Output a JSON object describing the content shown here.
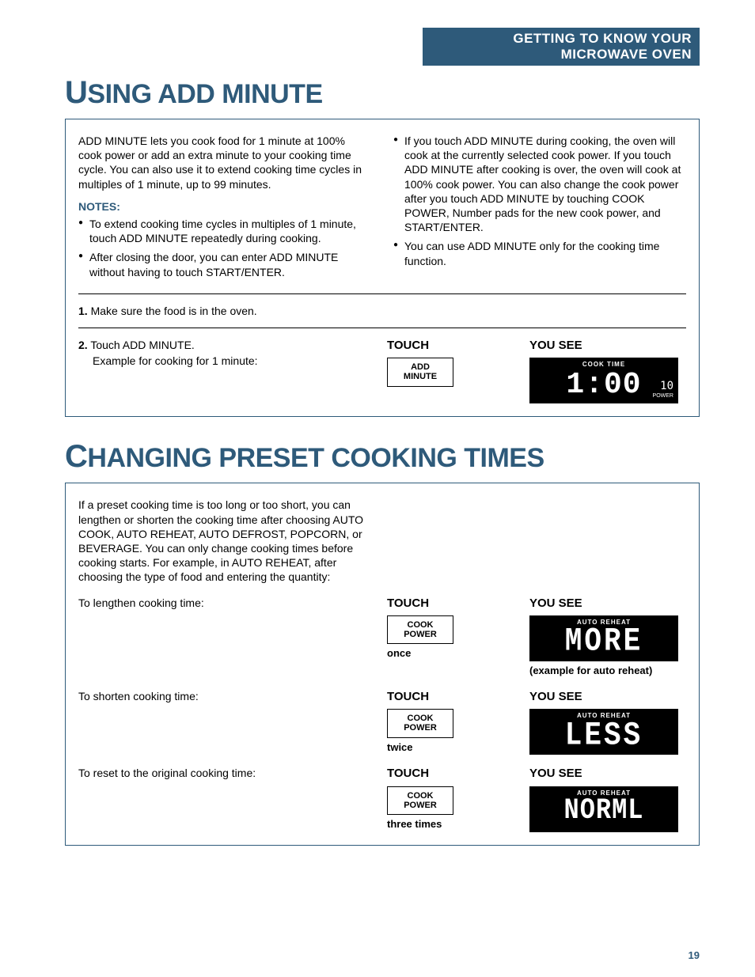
{
  "header": "GETTING TO KNOW YOUR MICROWAVE OVEN",
  "section1": {
    "title_pre": "U",
    "title_rest": "SING ADD MINUTE",
    "intro": "ADD MINUTE lets you cook food for 1 minute at 100% cook power or add an extra minute to your cooking time cycle. You can also use it to extend cooking time cycles in multiples of 1 minute, up to 99 minutes.",
    "notes_label": "NOTES:",
    "left_notes": [
      "To extend cooking time cycles in multiples of 1 minute, touch ADD MINUTE repeatedly during cooking.",
      "After closing the door, you can enter ADD MINUTE without having to touch START/ENTER."
    ],
    "right_notes": [
      "If you touch ADD MINUTE during cooking, the oven will cook at the currently selected cook power. If you touch ADD MINUTE after cooking is over, the oven will cook at 100% cook power. You can also change the cook power after you touch ADD MINUTE by touching COOK POWER, Number pads for the new cook power, and START/ENTER.",
      "You can use ADD MINUTE only for the cooking time function."
    ],
    "step1_num": "1.",
    "step1_text": "Make sure the food is in the oven.",
    "step2_num": "2.",
    "step2_text": "Touch ADD MINUTE.",
    "step2_example": "Example for cooking for 1 minute:",
    "touch_label": "TOUCH",
    "yousee_label": "YOU SEE",
    "button_line1": "ADD",
    "button_line2": "MINUTE",
    "lcd_top": "COOK  TIME",
    "lcd_time": "1:00",
    "lcd_power_num": "10",
    "lcd_power_label": "POWER"
  },
  "section2": {
    "title_pre": "C",
    "title_rest": "HANGING PRESET COOKING TIMES",
    "intro": "If a preset cooking time is too long or too short, you can lengthen or shorten the cooking time after choosing AUTO COOK, AUTO REHEAT, AUTO DEFROST, POPCORN, or BEVERAGE. You can only change cooking times before cooking starts. For example, in AUTO REHEAT, after choosing the type of food and entering the quantity:",
    "rows": [
      {
        "text": "To lengthen cooking time:",
        "touch_label": "TOUCH",
        "button_l1": "COOK",
        "button_l2": "POWER",
        "sub": "once",
        "yousee_label": "YOU SEE",
        "lcd_top": "AUTO  REHEAT",
        "lcd_big": "MORE",
        "caption": "(example for auto reheat)"
      },
      {
        "text": "To shorten cooking time:",
        "touch_label": "TOUCH",
        "button_l1": "COOK",
        "button_l2": "POWER",
        "sub": "twice",
        "yousee_label": "YOU SEE",
        "lcd_top": "AUTO  REHEAT",
        "lcd_big": "LESS",
        "caption": ""
      },
      {
        "text": "To reset to the original cooking time:",
        "touch_label": "TOUCH",
        "button_l1": "COOK",
        "button_l2": "POWER",
        "sub": "three times",
        "yousee_label": "YOU SEE",
        "lcd_top": "AUTO  REHEAT",
        "lcd_big": "NORML",
        "caption": ""
      }
    ]
  },
  "page_number": "19"
}
